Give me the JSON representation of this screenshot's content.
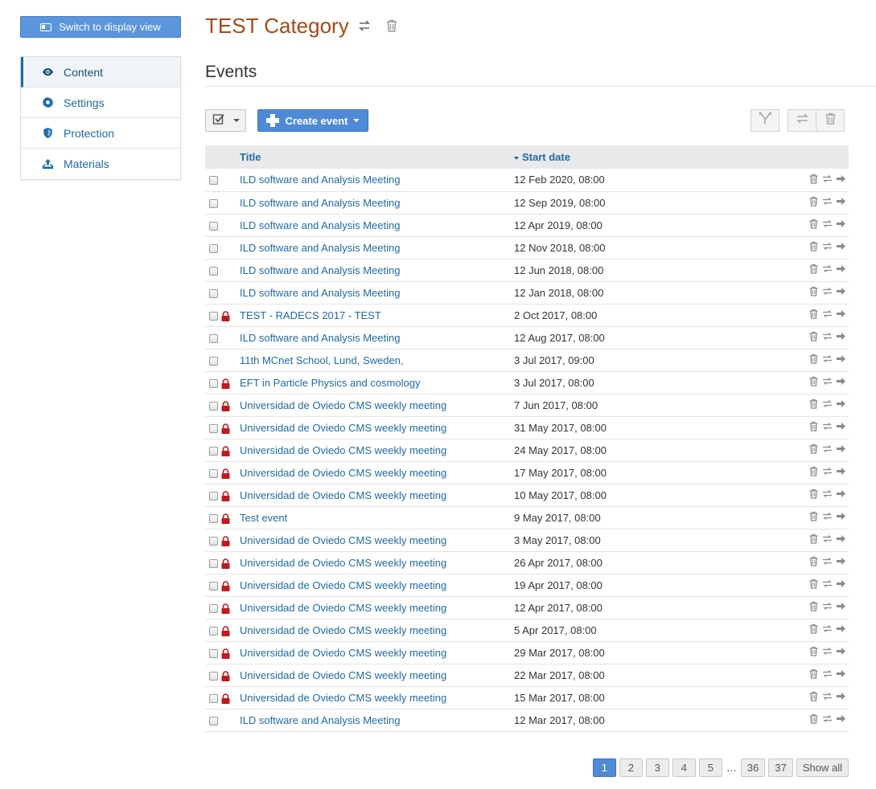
{
  "sidebar": {
    "switch_label": "Switch to display view",
    "items": [
      {
        "label": "Content",
        "icon": "eye-icon",
        "active": true
      },
      {
        "label": "Settings",
        "icon": "gear-icon",
        "active": false
      },
      {
        "label": "Protection",
        "icon": "shield-icon",
        "active": false
      },
      {
        "label": "Materials",
        "icon": "upload-icon",
        "active": false
      }
    ]
  },
  "header": {
    "title": "TEST Category",
    "section_title": "Events"
  },
  "toolbar": {
    "create_label": "Create event"
  },
  "table": {
    "columns": {
      "title": "Title",
      "start_date": "Start date"
    },
    "rows": [
      {
        "title": "ILD software and Analysis Meeting",
        "date": "12 Feb 2020, 08:00",
        "locked": false
      },
      {
        "title": "ILD software and Analysis Meeting",
        "date": "12 Sep 2019, 08:00",
        "locked": false
      },
      {
        "title": "ILD software and Analysis Meeting",
        "date": "12 Apr 2019, 08:00",
        "locked": false
      },
      {
        "title": "ILD software and Analysis Meeting",
        "date": "12 Nov 2018, 08:00",
        "locked": false
      },
      {
        "title": "ILD software and Analysis Meeting",
        "date": "12 Jun 2018, 08:00",
        "locked": false
      },
      {
        "title": "ILD software and Analysis Meeting",
        "date": "12 Jan 2018, 08:00",
        "locked": false
      },
      {
        "title": "TEST - RADECS 2017 - TEST",
        "date": "2 Oct 2017, 08:00",
        "locked": true
      },
      {
        "title": "ILD software and Analysis Meeting",
        "date": "12 Aug 2017, 08:00",
        "locked": false
      },
      {
        "title": "11th MCnet School, Lund, Sweden,",
        "date": "3 Jul 2017, 09:00",
        "locked": false
      },
      {
        "title": "EFT in Particle Physics and cosmology",
        "date": "3 Jul 2017, 08:00",
        "locked": true
      },
      {
        "title": "Universidad de Oviedo CMS weekly meeting",
        "date": "7 Jun 2017, 08:00",
        "locked": true
      },
      {
        "title": "Universidad de Oviedo CMS weekly meeting",
        "date": "31 May 2017, 08:00",
        "locked": true
      },
      {
        "title": "Universidad de Oviedo CMS weekly meeting",
        "date": "24 May 2017, 08:00",
        "locked": true
      },
      {
        "title": "Universidad de Oviedo CMS weekly meeting",
        "date": "17 May 2017, 08:00",
        "locked": true
      },
      {
        "title": "Universidad de Oviedo CMS weekly meeting",
        "date": "10 May 2017, 08:00",
        "locked": true
      },
      {
        "title": "Test event",
        "date": "9 May 2017, 08:00",
        "locked": true
      },
      {
        "title": "Universidad de Oviedo CMS weekly meeting",
        "date": "3 May 2017, 08:00",
        "locked": true
      },
      {
        "title": "Universidad de Oviedo CMS weekly meeting",
        "date": "26 Apr 2017, 08:00",
        "locked": true
      },
      {
        "title": "Universidad de Oviedo CMS weekly meeting",
        "date": "19 Apr 2017, 08:00",
        "locked": true
      },
      {
        "title": "Universidad de Oviedo CMS weekly meeting",
        "date": "12 Apr 2017, 08:00",
        "locked": true
      },
      {
        "title": "Universidad de Oviedo CMS weekly meeting",
        "date": "5 Apr 2017, 08:00",
        "locked": true
      },
      {
        "title": "Universidad de Oviedo CMS weekly meeting",
        "date": "29 Mar 2017, 08:00",
        "locked": true
      },
      {
        "title": "Universidad de Oviedo CMS weekly meeting",
        "date": "22 Mar 2017, 08:00",
        "locked": true
      },
      {
        "title": "Universidad de Oviedo CMS weekly meeting",
        "date": "15 Mar 2017, 08:00",
        "locked": true
      },
      {
        "title": "ILD software and Analysis Meeting",
        "date": "12 Mar 2017, 08:00",
        "locked": false
      }
    ]
  },
  "pagination": {
    "pages": [
      "1",
      "2",
      "3",
      "4",
      "5"
    ],
    "active": "1",
    "ellipsis": "…",
    "last_pages": [
      "36",
      "37"
    ],
    "show_all": "Show all"
  },
  "colors": {
    "accent": "#4e8ad6",
    "link": "#1f6aa6",
    "title": "#a34b17",
    "lock": "#c0191f"
  }
}
